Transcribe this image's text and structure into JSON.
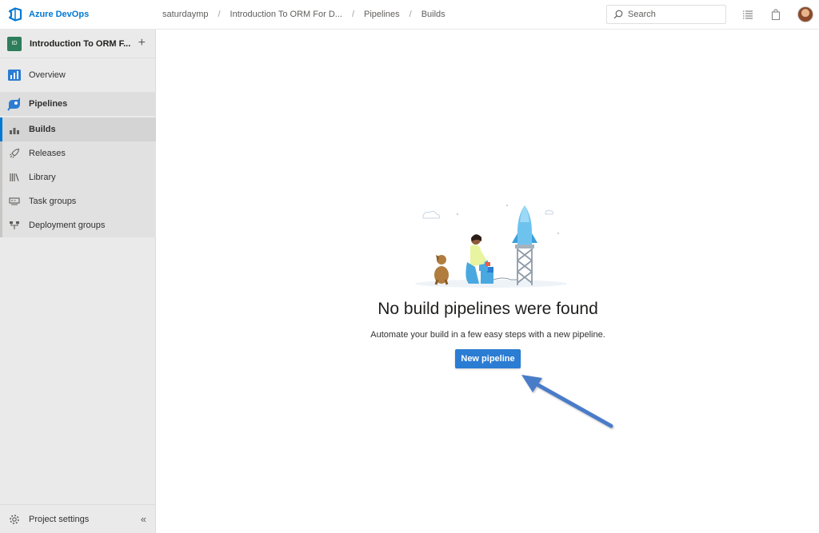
{
  "header": {
    "brand": "Azure DevOps",
    "breadcrumbs": [
      "saturdaymp",
      "Introduction To ORM For D...",
      "Pipelines",
      "Builds"
    ],
    "separator": "/",
    "search_placeholder": "Search"
  },
  "sidebar": {
    "project_badge": "ID",
    "project_name": "Introduction To ORM F...",
    "overview": "Overview",
    "pipelines": "Pipelines",
    "items": [
      "Builds",
      "Releases",
      "Library",
      "Task groups",
      "Deployment groups"
    ],
    "active_item": "Builds",
    "settings": "Project settings"
  },
  "main": {
    "title": "No build pipelines were found",
    "description": "Automate your build in a few easy steps with a new pipeline.",
    "button": "New pipeline"
  },
  "colors": {
    "accent": "#0078d4",
    "button": "#2b7cd3",
    "annotation_arrow": "#4a7bc8"
  }
}
